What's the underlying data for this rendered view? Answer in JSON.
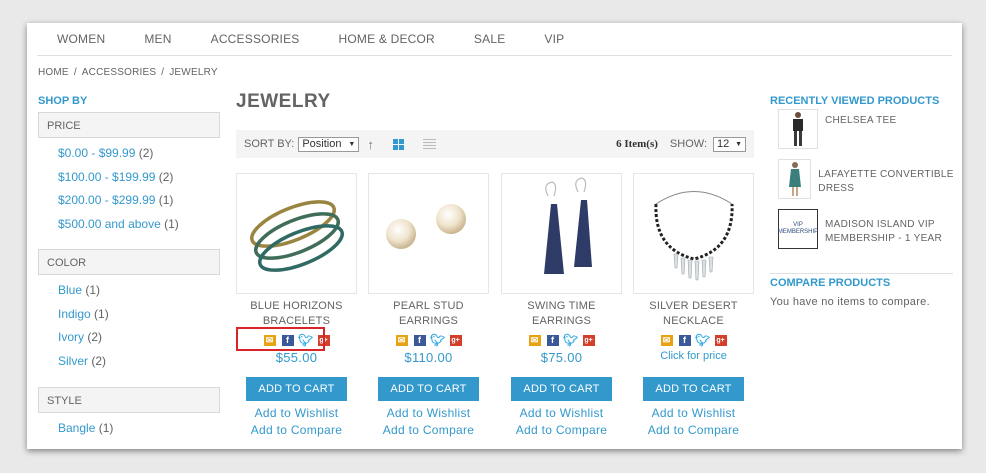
{
  "nav": [
    "WOMEN",
    "MEN",
    "ACCESSORIES",
    "HOME & DECOR",
    "SALE",
    "VIP"
  ],
  "breadcrumb": [
    "HOME",
    "ACCESSORIES",
    "JEWELRY"
  ],
  "sidebar": {
    "title": "SHOP BY",
    "facets": [
      {
        "label": "PRICE",
        "options": [
          {
            "name": "$0.00 - $99.99",
            "count": "(2)"
          },
          {
            "name": "$100.00 - $199.99",
            "count": "(2)"
          },
          {
            "name": "$200.00 - $299.99",
            "count": "(1)"
          },
          {
            "name": "$500.00 and above",
            "count": "(1)"
          }
        ]
      },
      {
        "label": "COLOR",
        "options": [
          {
            "name": "Blue",
            "count": "(1)"
          },
          {
            "name": "Indigo",
            "count": "(1)"
          },
          {
            "name": "Ivory",
            "count": "(2)"
          },
          {
            "name": "Silver",
            "count": "(2)"
          }
        ]
      },
      {
        "label": "STYLE",
        "options": [
          {
            "name": "Bangle",
            "count": "(1)"
          }
        ]
      }
    ]
  },
  "page_title": "JEWELRY",
  "toolbar": {
    "sort_label": "SORT BY:",
    "sort_value": "Position",
    "items_count": "6 Item(s)",
    "show_label": "SHOW:",
    "show_value": "12"
  },
  "products": [
    {
      "name": "BLUE HORIZONS BRACELETS",
      "price": "$55.00",
      "cart": "ADD TO CART",
      "wishlist": "Add to Wishlist",
      "compare": "Add to Compare"
    },
    {
      "name": "PEARL STUD EARRINGS",
      "price": "$110.00",
      "cart": "ADD TO CART",
      "wishlist": "Add to Wishlist",
      "compare": "Add to Compare"
    },
    {
      "name": "SWING TIME EARRINGS",
      "price": "$75.00",
      "cart": "ADD TO CART",
      "wishlist": "Add to Wishlist",
      "compare": "Add to Compare"
    },
    {
      "name": "SILVER DESERT NECKLACE",
      "price": "Click for price",
      "cart": "ADD TO CART",
      "wishlist": "Add to Wishlist",
      "compare": "Add to Compare"
    }
  ],
  "recently_viewed": {
    "title": "RECENTLY VIEWED PRODUCTS",
    "items": [
      "CHELSEA TEE",
      "LAFAYETTE CONVERTIBLE DRESS",
      "MADISON ISLAND VIP MEMBERSHIP - 1 YEAR"
    ],
    "vip_thumb_text": "VIP MEMBERSHIP"
  },
  "compare": {
    "title": "COMPARE PRODUCTS",
    "empty_text": "You have no items to compare."
  },
  "colors": {
    "accent": "#3399cc",
    "text": "#636363",
    "highlight": "#d9252a"
  }
}
